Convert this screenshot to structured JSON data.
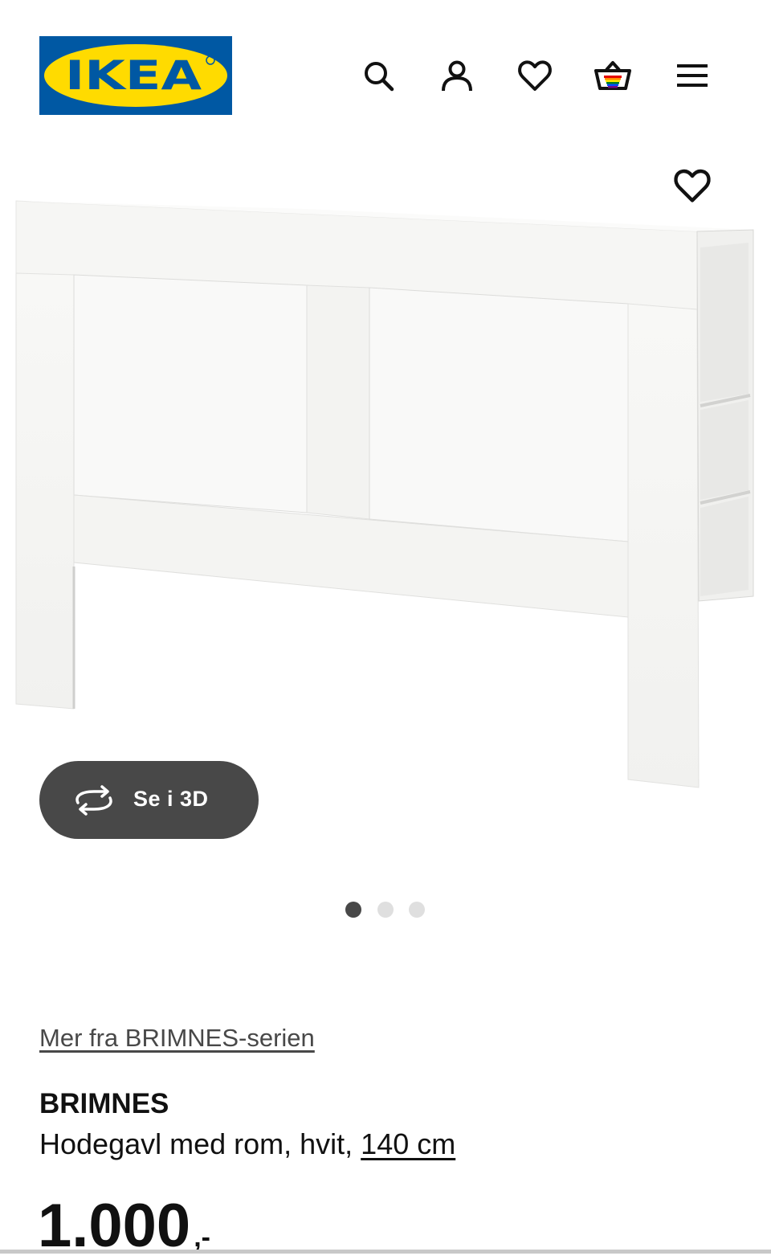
{
  "header": {
    "logo_text": "IKEA",
    "icons": [
      "search-icon",
      "user-icon",
      "heart-icon",
      "cart-icon",
      "menu-icon"
    ]
  },
  "product_image": {
    "favorite_icon": "heart-icon",
    "view_3d_label": "Se i 3D",
    "view_3d_icon": "rotate-3d-icon",
    "carousel": {
      "count": 3,
      "active": 1
    }
  },
  "product": {
    "series_link": "Mer fra BRIMNES-serien",
    "name": "BRIMNES",
    "description": "Hodegavl med rom, hvit, ",
    "size_link": "140 cm",
    "price": "1.000",
    "price_suffix": ",-"
  },
  "colors": {
    "ikea_blue": "#0058a3",
    "ikea_yellow": "#ffdb00",
    "dark_grey": "#484848",
    "text": "#111111"
  }
}
